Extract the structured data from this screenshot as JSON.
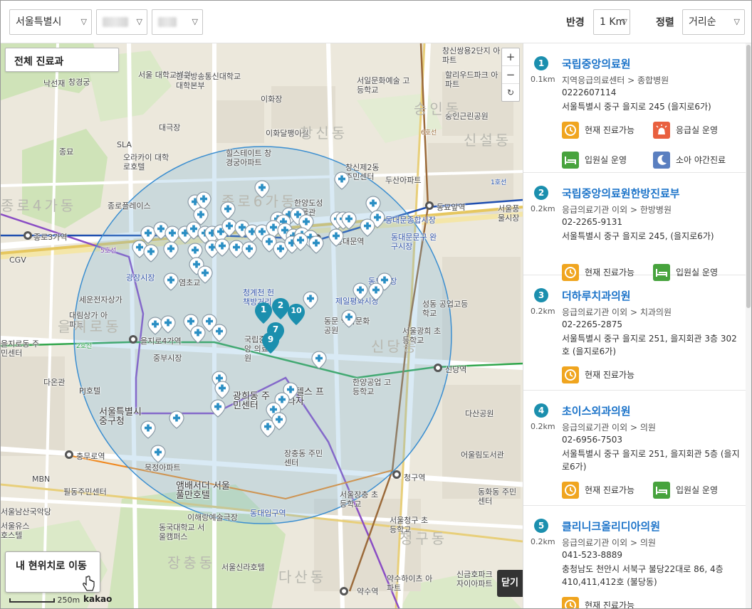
{
  "toolbar": {
    "region_select": "서울특별시",
    "radius_label": "반경",
    "radius_value": "1 Km",
    "sort_label": "정렬",
    "sort_value": "거리순"
  },
  "map": {
    "department_button": "전체 진료과",
    "zoom_in": "+",
    "zoom_out": "−",
    "refresh": "↻",
    "my_location_button": "내 현위치로 이동",
    "scale_text": "250m",
    "provider": "kakao",
    "close_button": "닫기",
    "labels": {
      "l1": "서울 대학교병원",
      "l2": "한국방송통신대학교 대학본부",
      "l3": "이화장",
      "l4": "서일문화예술 고등학교",
      "l5": "할리우드파크 아파트",
      "l6": "창신쌍용2단지 아파트",
      "l7": "숭인근린공원",
      "l8": "낙선재",
      "l9": "창경궁",
      "l10": "대극장",
      "l11": "이화달팽이길",
      "l12": "종묘",
      "l13": "SLA",
      "l14": "오라카이 대학로호텔",
      "l15": "힐스테이트 창경궁아파트",
      "l16": "창신제2동 주민센터",
      "l17": "두산아파트",
      "l18": "동묘앞역",
      "l19": "서울풍물시장",
      "l20": "종로플레이스",
      "l21": "한양도성 박물관",
      "l22": "동대문종합시장",
      "l23": "종로3가역",
      "l24": "CGV",
      "l25": "동대문역",
      "l26": "동대문문구 완구시장",
      "l27": "광장시장",
      "l28": "염초교",
      "l29": "세운전자상가",
      "l30": "청계천 헌책방거리",
      "l31": "제일평화시장",
      "l32": "동묘시장",
      "l33": "대림상가 아파트",
      "l34": "동문 역사문화공원",
      "l35": "성동 공업고등학교",
      "l36": "을지로동 주민센터",
      "l37": "을지로4가역",
      "l38": "국립중앙 의료원",
      "l39": "서울광희 초등학교",
      "l40": "중부시장",
      "l41": "신당역",
      "l42": "다온관",
      "l43": "PJ호텔",
      "l44": "광희동 주민센터",
      "l45": "호텔스 프라자",
      "l46": "한양공업 고등학교",
      "l47": "서울특별시 중구청",
      "l48": "다산공원",
      "l49": "충무로역",
      "l50": "장충동 주민센터",
      "l51": "묵정아파트",
      "l52": "어울림도서관",
      "l53": "MBN",
      "l54": "필동주민센터",
      "l55": "앰배서더 서울풀만호텔",
      "l56": "청구역",
      "l57": "서울장충 초등학교",
      "l58": "동화동 주민센터",
      "l59": "서울남산국악당",
      "l60": "동국대학교 서울캠퍼스",
      "l61": "이해랑예술극장",
      "l62": "서울청구 초등학교",
      "l63": "서울유스 호스텔",
      "l64": "서울신라호텔",
      "l65": "약수역",
      "l66": "약수하이츠 아파트",
      "l67": "신금호파크 자이아파트",
      "l68": "동대입구역",
      "l69": "봉제역사관",
      "l70": "신당동 다산빌딩",
      "l71": "장충동",
      "l72": "청구동",
      "l73": "다산동",
      "l74": "신당동",
      "l75": "숭인동",
      "l76": "종로4가동",
      "l77": "을지로동",
      "l78": "창신동",
      "l79": "신설동",
      "l80": "종로6가동",
      "l81": "5호선",
      "l82": "1호선",
      "l83": "2호선",
      "l84": "6호선"
    },
    "marker_numbers": [
      "1",
      "2",
      "10",
      "7",
      "9"
    ]
  },
  "results": [
    {
      "rank": "1",
      "distance": "0.1km",
      "name": "국립중앙의료원",
      "category": "지역응급의료센터 > 종합병원",
      "phone": "0222607114",
      "address": "서울특별시 중구 을지로 245 (을지로6가)",
      "badges": [
        {
          "label": "현재 진료가능",
          "icon": "clock-icon",
          "color": "#f0a51f"
        },
        {
          "label": "응급실 운영",
          "icon": "siren-icon",
          "color": "#e9603f"
        },
        {
          "label": "입원실 운영",
          "icon": "bed-icon",
          "color": "#47a33d"
        },
        {
          "label": "소아 야간진료",
          "icon": "moon-icon",
          "color": "#5a7fc0"
        }
      ]
    },
    {
      "rank": "2",
      "distance": "0.2km",
      "name": "국립중앙의료원한방진료부",
      "category": "응급의료기관 이외 > 한방병원",
      "phone": "02-2265-9131",
      "address": "서울특별시 중구 을지로 245, (을지로6가)",
      "badges": [
        {
          "label": "현재 진료가능",
          "icon": "clock-icon",
          "color": "#f0a51f"
        },
        {
          "label": "입원실 운영",
          "icon": "bed-icon",
          "color": "#47a33d"
        }
      ]
    },
    {
      "rank": "3",
      "distance": "0.2km",
      "name": "더하루치과의원",
      "category": "응급의료기관 이외 > 치과의원",
      "phone": "02-2265-2875",
      "address": "서울특별시 중구 을지로 251, 을지회관 3층 302호 (을지로6가)",
      "badges": [
        {
          "label": "현재 진료가능",
          "icon": "clock-icon",
          "color": "#f0a51f"
        }
      ]
    },
    {
      "rank": "4",
      "distance": "0.2km",
      "name": "초이스외과의원",
      "category": "응급의료기관 이외 > 의원",
      "phone": "02-6956-7503",
      "address": "서울특별시 중구 을지로 251, 을지회관 5층 (을지로6가)",
      "badges": [
        {
          "label": "현재 진료가능",
          "icon": "clock-icon",
          "color": "#f0a51f"
        },
        {
          "label": "입원실 운영",
          "icon": "bed-icon",
          "color": "#47a33d"
        }
      ]
    },
    {
      "rank": "5",
      "distance": "0.2km",
      "name": "클리니크올리디아의원",
      "category": "응급의료기관 이외 > 의원",
      "phone": "041-523-8889",
      "address": "충청남도 천안시 서북구 불당22대로 86, 4층 410,411,412호 (불당동)",
      "badges": [
        {
          "label": "현재 진료가능",
          "icon": "clock-icon",
          "color": "#f0a51f"
        }
      ]
    }
  ]
}
